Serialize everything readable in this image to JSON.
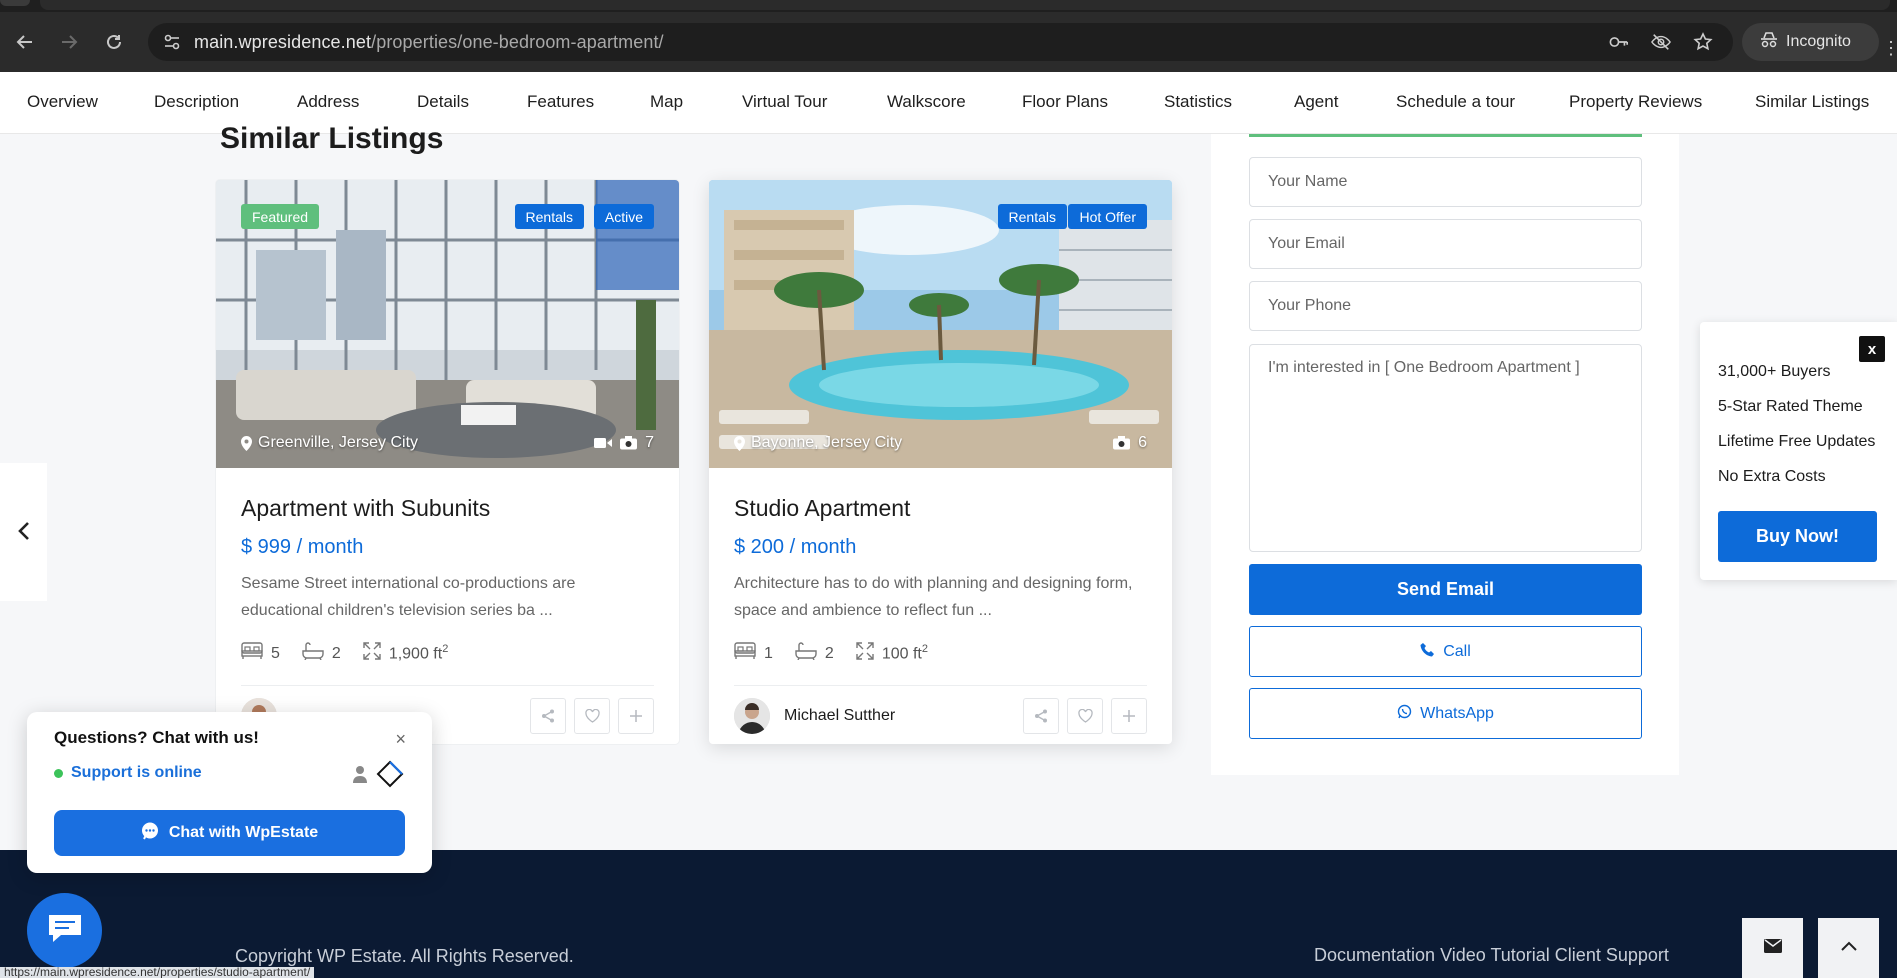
{
  "browser": {
    "url_host": "main.wpresidence.net",
    "url_path": "/properties/one-bedroom-apartment/",
    "profile_label": "Incognito",
    "status_url": "https://main.wpresidence.net/properties/studio-apartment/"
  },
  "section_nav": {
    "items": [
      {
        "label": "Overview"
      },
      {
        "label": "Description"
      },
      {
        "label": "Address"
      },
      {
        "label": "Details"
      },
      {
        "label": "Features"
      },
      {
        "label": "Map"
      },
      {
        "label": "Virtual Tour"
      },
      {
        "label": "Walkscore"
      },
      {
        "label": "Floor Plans"
      },
      {
        "label": "Statistics"
      },
      {
        "label": "Agent"
      },
      {
        "label": "Schedule a tour"
      },
      {
        "label": "Property Reviews"
      },
      {
        "label": "Similar Listings"
      }
    ]
  },
  "similar": {
    "title": "Similar Listings",
    "cards": [
      {
        "badges_left": [
          "Featured"
        ],
        "badges_right": [
          "Rentals",
          "Active"
        ],
        "location": "Greenville, Jersey City",
        "photo_count": "7",
        "title": "Apartment with Subunits",
        "price": "$ 999",
        "price_period": "/ month",
        "description": "Sesame Street international co-productions are educational children's television series ba ...",
        "beds": "5",
        "baths": "2",
        "area": "1,900 ft",
        "area_unit_sup": "2",
        "agent_name": ""
      },
      {
        "badges_left": [],
        "badges_right": [
          "Rentals",
          "Hot Offer"
        ],
        "location": "Bayonne, Jersey City",
        "photo_count": "6",
        "title": "Studio Apartment",
        "price": "$ 200",
        "price_period": "/ month",
        "description": "Architecture has to do with planning and designing form, space and ambience to reflect fun ...",
        "beds": "1",
        "baths": "2",
        "area": "100 ft",
        "area_unit_sup": "2",
        "agent_name": "Michael Sutther"
      }
    ]
  },
  "contact": {
    "name_placeholder": "Your Name",
    "email_placeholder": "Your Email",
    "phone_placeholder": "Your Phone",
    "message": "I'm interested in [ One Bedroom Apartment ]",
    "send_label": "Send Email",
    "call_label": "Call",
    "whatsapp_label": "WhatsApp"
  },
  "promo": {
    "close_label": "x",
    "lines": [
      "31,000+ Buyers",
      "5-Star Rated Theme",
      "Lifetime Free Updates",
      "No Extra Costs"
    ],
    "buy_label": "Buy Now!"
  },
  "chat": {
    "question": "Questions? Chat with us!",
    "close_label": "×",
    "status": "Support is online",
    "button_label": "Chat with WpEstate"
  },
  "footer": {
    "copyright": "Copyright WP Estate. All Rights Reserved.",
    "links": "Documentation Video Tutorial Client Support"
  },
  "colors": {
    "accent": "#0d6bd9",
    "featured_badge": "#5fbf7d",
    "footer_bg": "#0b1a33",
    "online_dot": "#3cc35a"
  }
}
